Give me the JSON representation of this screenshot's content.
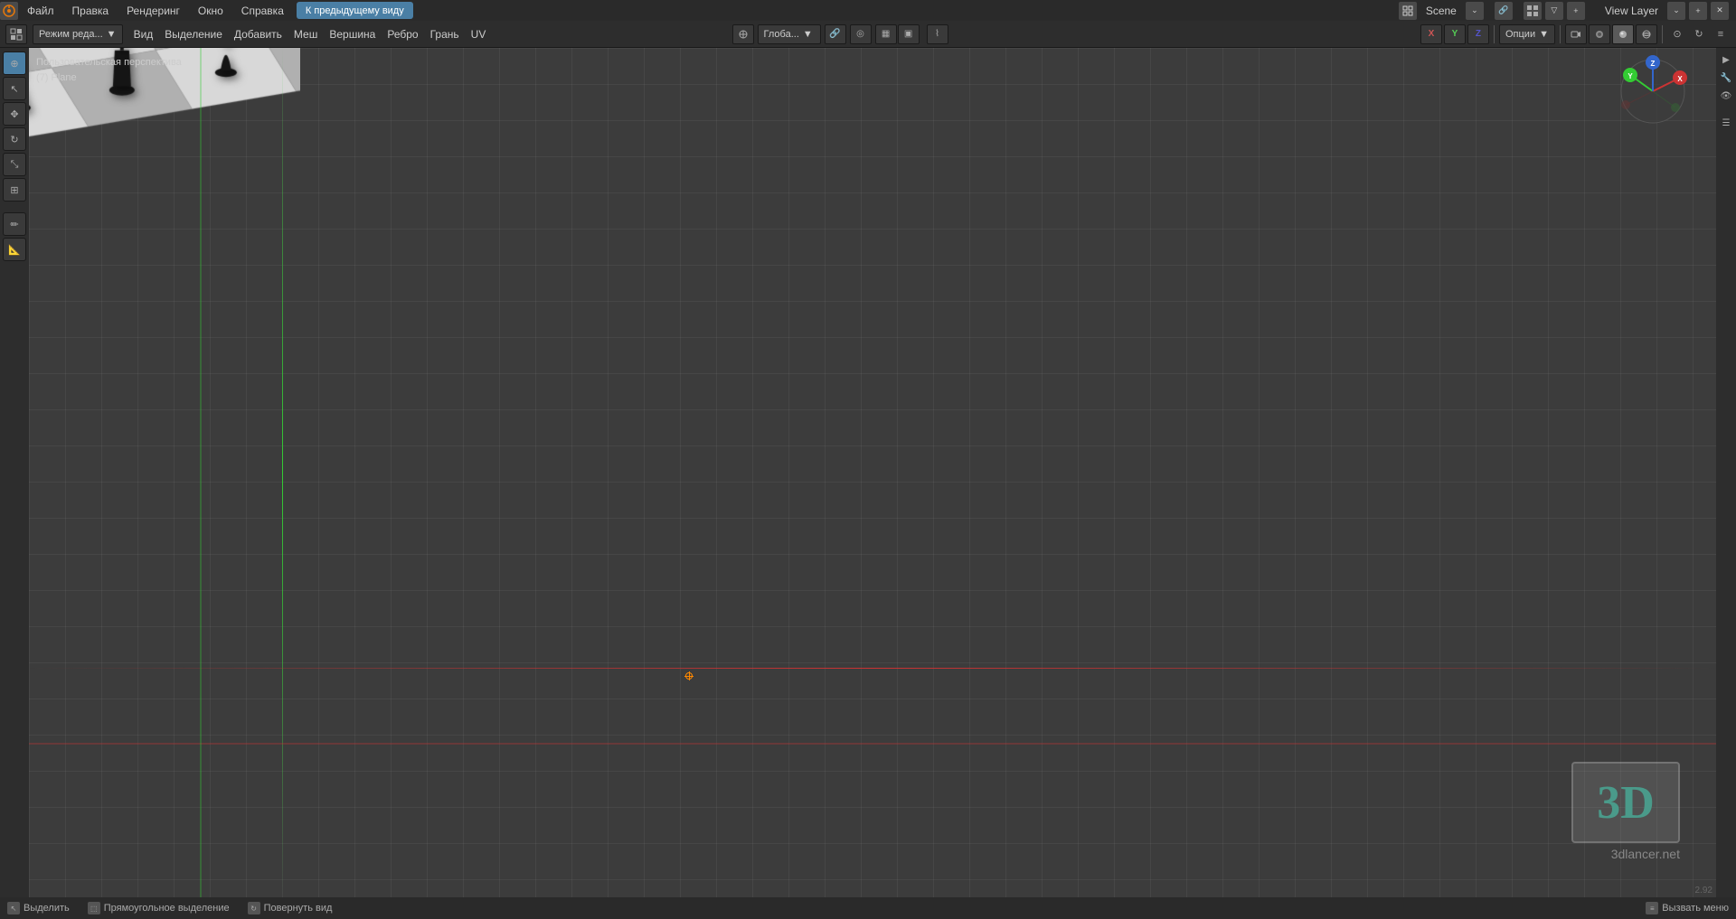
{
  "app": {
    "title": "Blender",
    "version": "2.92"
  },
  "topMenu": {
    "items": [
      "Файл",
      "Правка",
      "Рендеринг",
      "Окно",
      "Справка"
    ],
    "goBackLabel": "К предыдущему виду",
    "sceneLabel": "Scene",
    "viewLayerLabel": "View Layer"
  },
  "toolbar": {
    "modeLabel": "Режим реда...",
    "menus": [
      "Вид",
      "Выделение",
      "Добавить",
      "Меш",
      "Вершина",
      "Ребро",
      "Грань",
      "UV"
    ],
    "globalLabel": "Глоба...",
    "optionsLabel": "Опции"
  },
  "viewport": {
    "perspectiveLabel": "Пользовательская перспектива",
    "objectLabel": "(7) Plane"
  },
  "statusBar": {
    "items": [
      {
        "icon": "select-icon",
        "label": "Выделить"
      },
      {
        "icon": "rect-select-icon",
        "label": "Прямоугольное выделение"
      },
      {
        "icon": "rotate-icon",
        "label": "Повернуть вид"
      },
      {
        "icon": "menu-icon",
        "label": "Вызвать меню"
      }
    ]
  },
  "watermark": {
    "text3d": "3D",
    "siteLabel": "3dlancer.net"
  },
  "gizmo": {
    "xColor": "#cc3333",
    "yColor": "#33cc33",
    "zColor": "#3366cc",
    "xLabel": "X",
    "yLabel": "Y",
    "zLabel": "Z"
  },
  "icons": {
    "cursor": "⊕",
    "select": "↖",
    "move": "✥",
    "rotate": "↻",
    "scale": "⤡",
    "transform": "⊞",
    "annotate": "✏",
    "measure": "📏",
    "add": "+",
    "search": "🔍",
    "gear": "⚙",
    "grid": "▦",
    "dots": "⋮",
    "layers": "☰",
    "camera": "📷",
    "light": "💡",
    "material": "●",
    "texture": "▣",
    "nodes": "◈"
  }
}
